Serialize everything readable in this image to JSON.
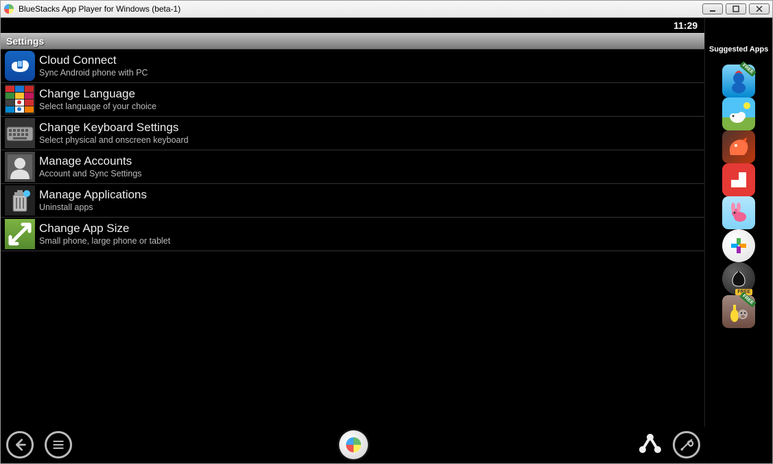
{
  "window": {
    "title": "BlueStacks App Player for Windows (beta-1)"
  },
  "status": {
    "time": "11:29"
  },
  "header": {
    "title": "Settings"
  },
  "settings": [
    {
      "title": "Cloud Connect",
      "subtitle": "Sync Android phone with PC",
      "icon": "cloud-connect-icon"
    },
    {
      "title": "Change Language",
      "subtitle": "Select language of your choice",
      "icon": "flags-icon"
    },
    {
      "title": "Change Keyboard Settings",
      "subtitle": "Select physical and onscreen keyboard",
      "icon": "keyboard-icon"
    },
    {
      "title": "Manage Accounts",
      "subtitle": "Account and Sync Settings",
      "icon": "accounts-icon"
    },
    {
      "title": "Manage Applications",
      "subtitle": "Uninstall apps",
      "icon": "applications-icon"
    },
    {
      "title": "Change App Size",
      "subtitle": "Small phone, large phone or tablet",
      "icon": "app-size-icon"
    }
  ],
  "sidebar": {
    "title": "Suggested Apps",
    "apps": [
      {
        "name": "app-smurfs",
        "bg1": "#4fc3f7",
        "bg2": "#0288d1",
        "badge": "FREE"
      },
      {
        "name": "app-clouds-sheep",
        "bg1": "#4fc3f7",
        "bg2": "#ffb300",
        "badge": ""
      },
      {
        "name": "app-dragon",
        "bg1": "#5d4037",
        "bg2": "#d84315",
        "badge": ""
      },
      {
        "name": "app-flipboard",
        "bg1": "#e53935",
        "bg2": "#e53935",
        "badge": ""
      },
      {
        "name": "app-bunny",
        "bg1": "#b3e5fc",
        "bg2": "#f06292",
        "badge": ""
      },
      {
        "name": "app-tunein",
        "bg1": "#ffffff",
        "bg2": "#e0e0e0",
        "badge": ""
      },
      {
        "name": "app-spades",
        "bg1": "#424242",
        "bg2": "#212121",
        "badge": "FREE"
      },
      {
        "name": "app-animals",
        "bg1": "#8d6e63",
        "bg2": "#a1887f",
        "badge": "FREE"
      }
    ]
  },
  "nav": {
    "back": "back-icon",
    "menu": "menu-icon",
    "home": "home-logo-icon",
    "share": "share-icon",
    "tools": "tools-icon"
  }
}
